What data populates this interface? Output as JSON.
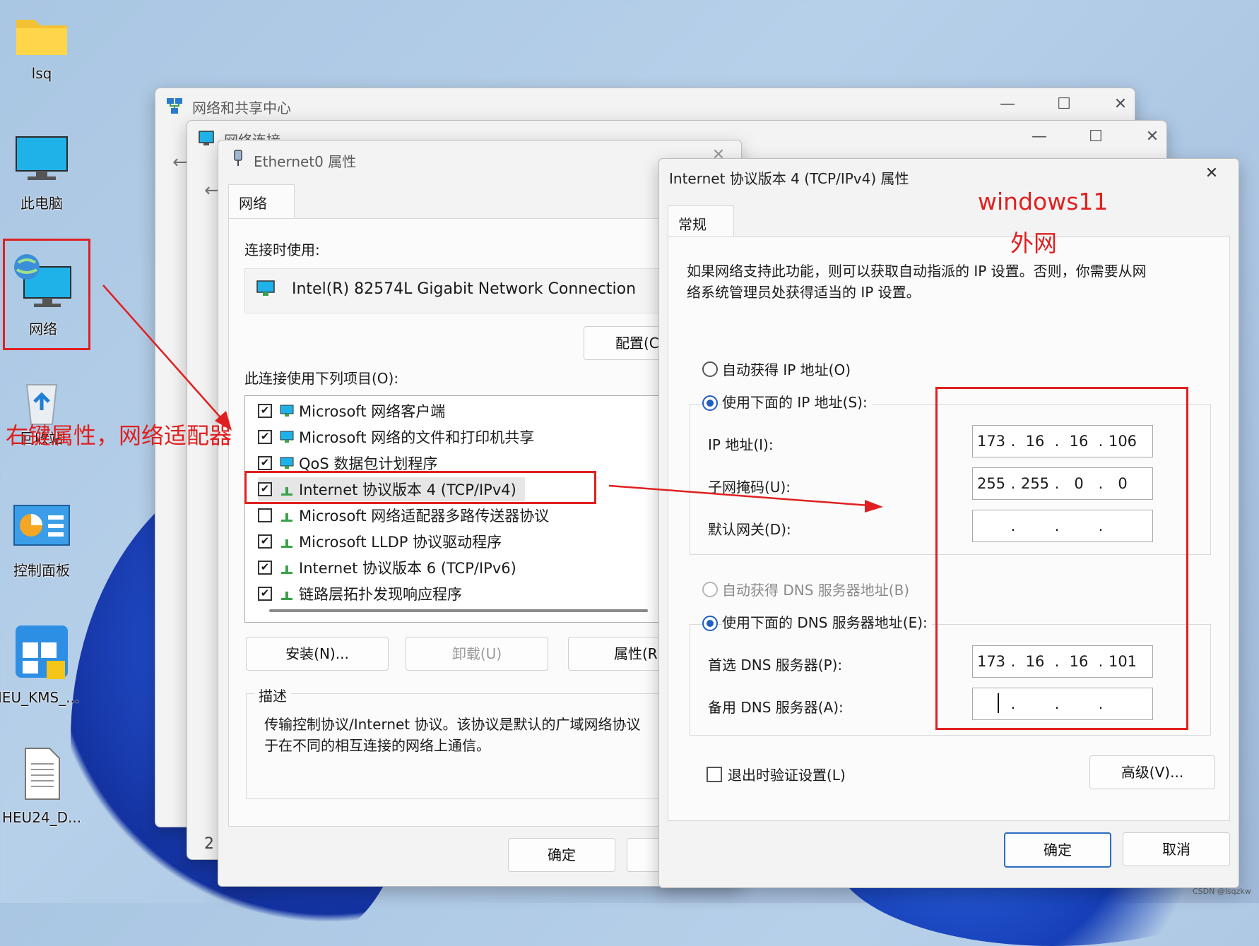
{
  "desktop": {
    "icons": [
      {
        "label": "lsq"
      },
      {
        "label": "此电脑"
      },
      {
        "label": "网络"
      },
      {
        "label": "回收站"
      },
      {
        "label": "控制面板"
      },
      {
        "label": "HEU_KMS_..."
      },
      {
        "label": "HEU24_D..."
      }
    ]
  },
  "annotations": {
    "left_note": "右键属性，网络适配器",
    "os_note": "windows11",
    "net_note": "外网",
    "watermark": "CSDN @lsqzkw",
    "color": "#e02020"
  },
  "win_sharing_center": {
    "title": "网络和共享中心"
  },
  "win_connections": {
    "title": "网络连接",
    "footer_num": "2"
  },
  "win_ethernet": {
    "title": "Ethernet0 属性",
    "tab": "网络",
    "connect_using_label": "连接时使用:",
    "adapter": "Intel(R) 82574L Gigabit Network Connection",
    "configure_btn": "配置(C",
    "items_label": "此连接使用下列项目(O):",
    "items": [
      {
        "label": "Microsoft 网络客户端",
        "checked": "✔"
      },
      {
        "label": "Microsoft 网络的文件和打印机共享",
        "checked": "✔"
      },
      {
        "label": "QoS 数据包计划程序",
        "checked": "✔"
      },
      {
        "label": "Internet 协议版本 4 (TCP/IPv4)",
        "checked": "✔"
      },
      {
        "label": "Microsoft 网络适配器多路传送器协议",
        "checked": ""
      },
      {
        "label": "Microsoft LLDP 协议驱动程序",
        "checked": "✔"
      },
      {
        "label": "Internet 协议版本 6 (TCP/IPv6)",
        "checked": "✔"
      },
      {
        "label": "链路层拓扑发现响应程序",
        "checked": "✔"
      }
    ],
    "install_btn": "安装(N)...",
    "uninstall_btn": "卸载(U)",
    "properties_btn": "属性(R",
    "description_label": "描述",
    "description_line1": "传输控制协议/Internet 协议。该协议是默认的广域网络协议",
    "description_line2": "于在不同的相互连接的网络上通信。",
    "ok_btn": "确定"
  },
  "win_ipv4": {
    "title": "Internet 协议版本 4 (TCP/IPv4) 属性",
    "tab": "常规",
    "intro_line1": "如果网络支持此功能，则可以获取自动指派的 IP 设置。否则，你需要从网",
    "intro_line2": "络系统管理员处获得适当的 IP 设置。",
    "auto_ip": "自动获得 IP 地址(O)",
    "manual_ip": "使用下面的 IP 地址(S):",
    "ip_label": "IP 地址(I):",
    "ip": [
      "173",
      "16",
      "16",
      "106"
    ],
    "mask_label": "子网掩码(U):",
    "mask": [
      "255",
      "255",
      "0",
      "0"
    ],
    "gateway_label": "默认网关(D):",
    "gateway": [
      "",
      "",
      "",
      ""
    ],
    "auto_dns": "自动获得 DNS 服务器地址(B)",
    "manual_dns": "使用下面的 DNS 服务器地址(E):",
    "dns1_label": "首选 DNS 服务器(P):",
    "dns1": [
      "173",
      "16",
      "16",
      "101"
    ],
    "dns2_label": "备用 DNS 服务器(A):",
    "dns2": [
      "",
      "",
      "",
      ""
    ],
    "validate_label": "退出时验证设置(L)",
    "advanced_btn": "高级(V)...",
    "ok_btn": "确定",
    "cancel_btn": "取消"
  }
}
